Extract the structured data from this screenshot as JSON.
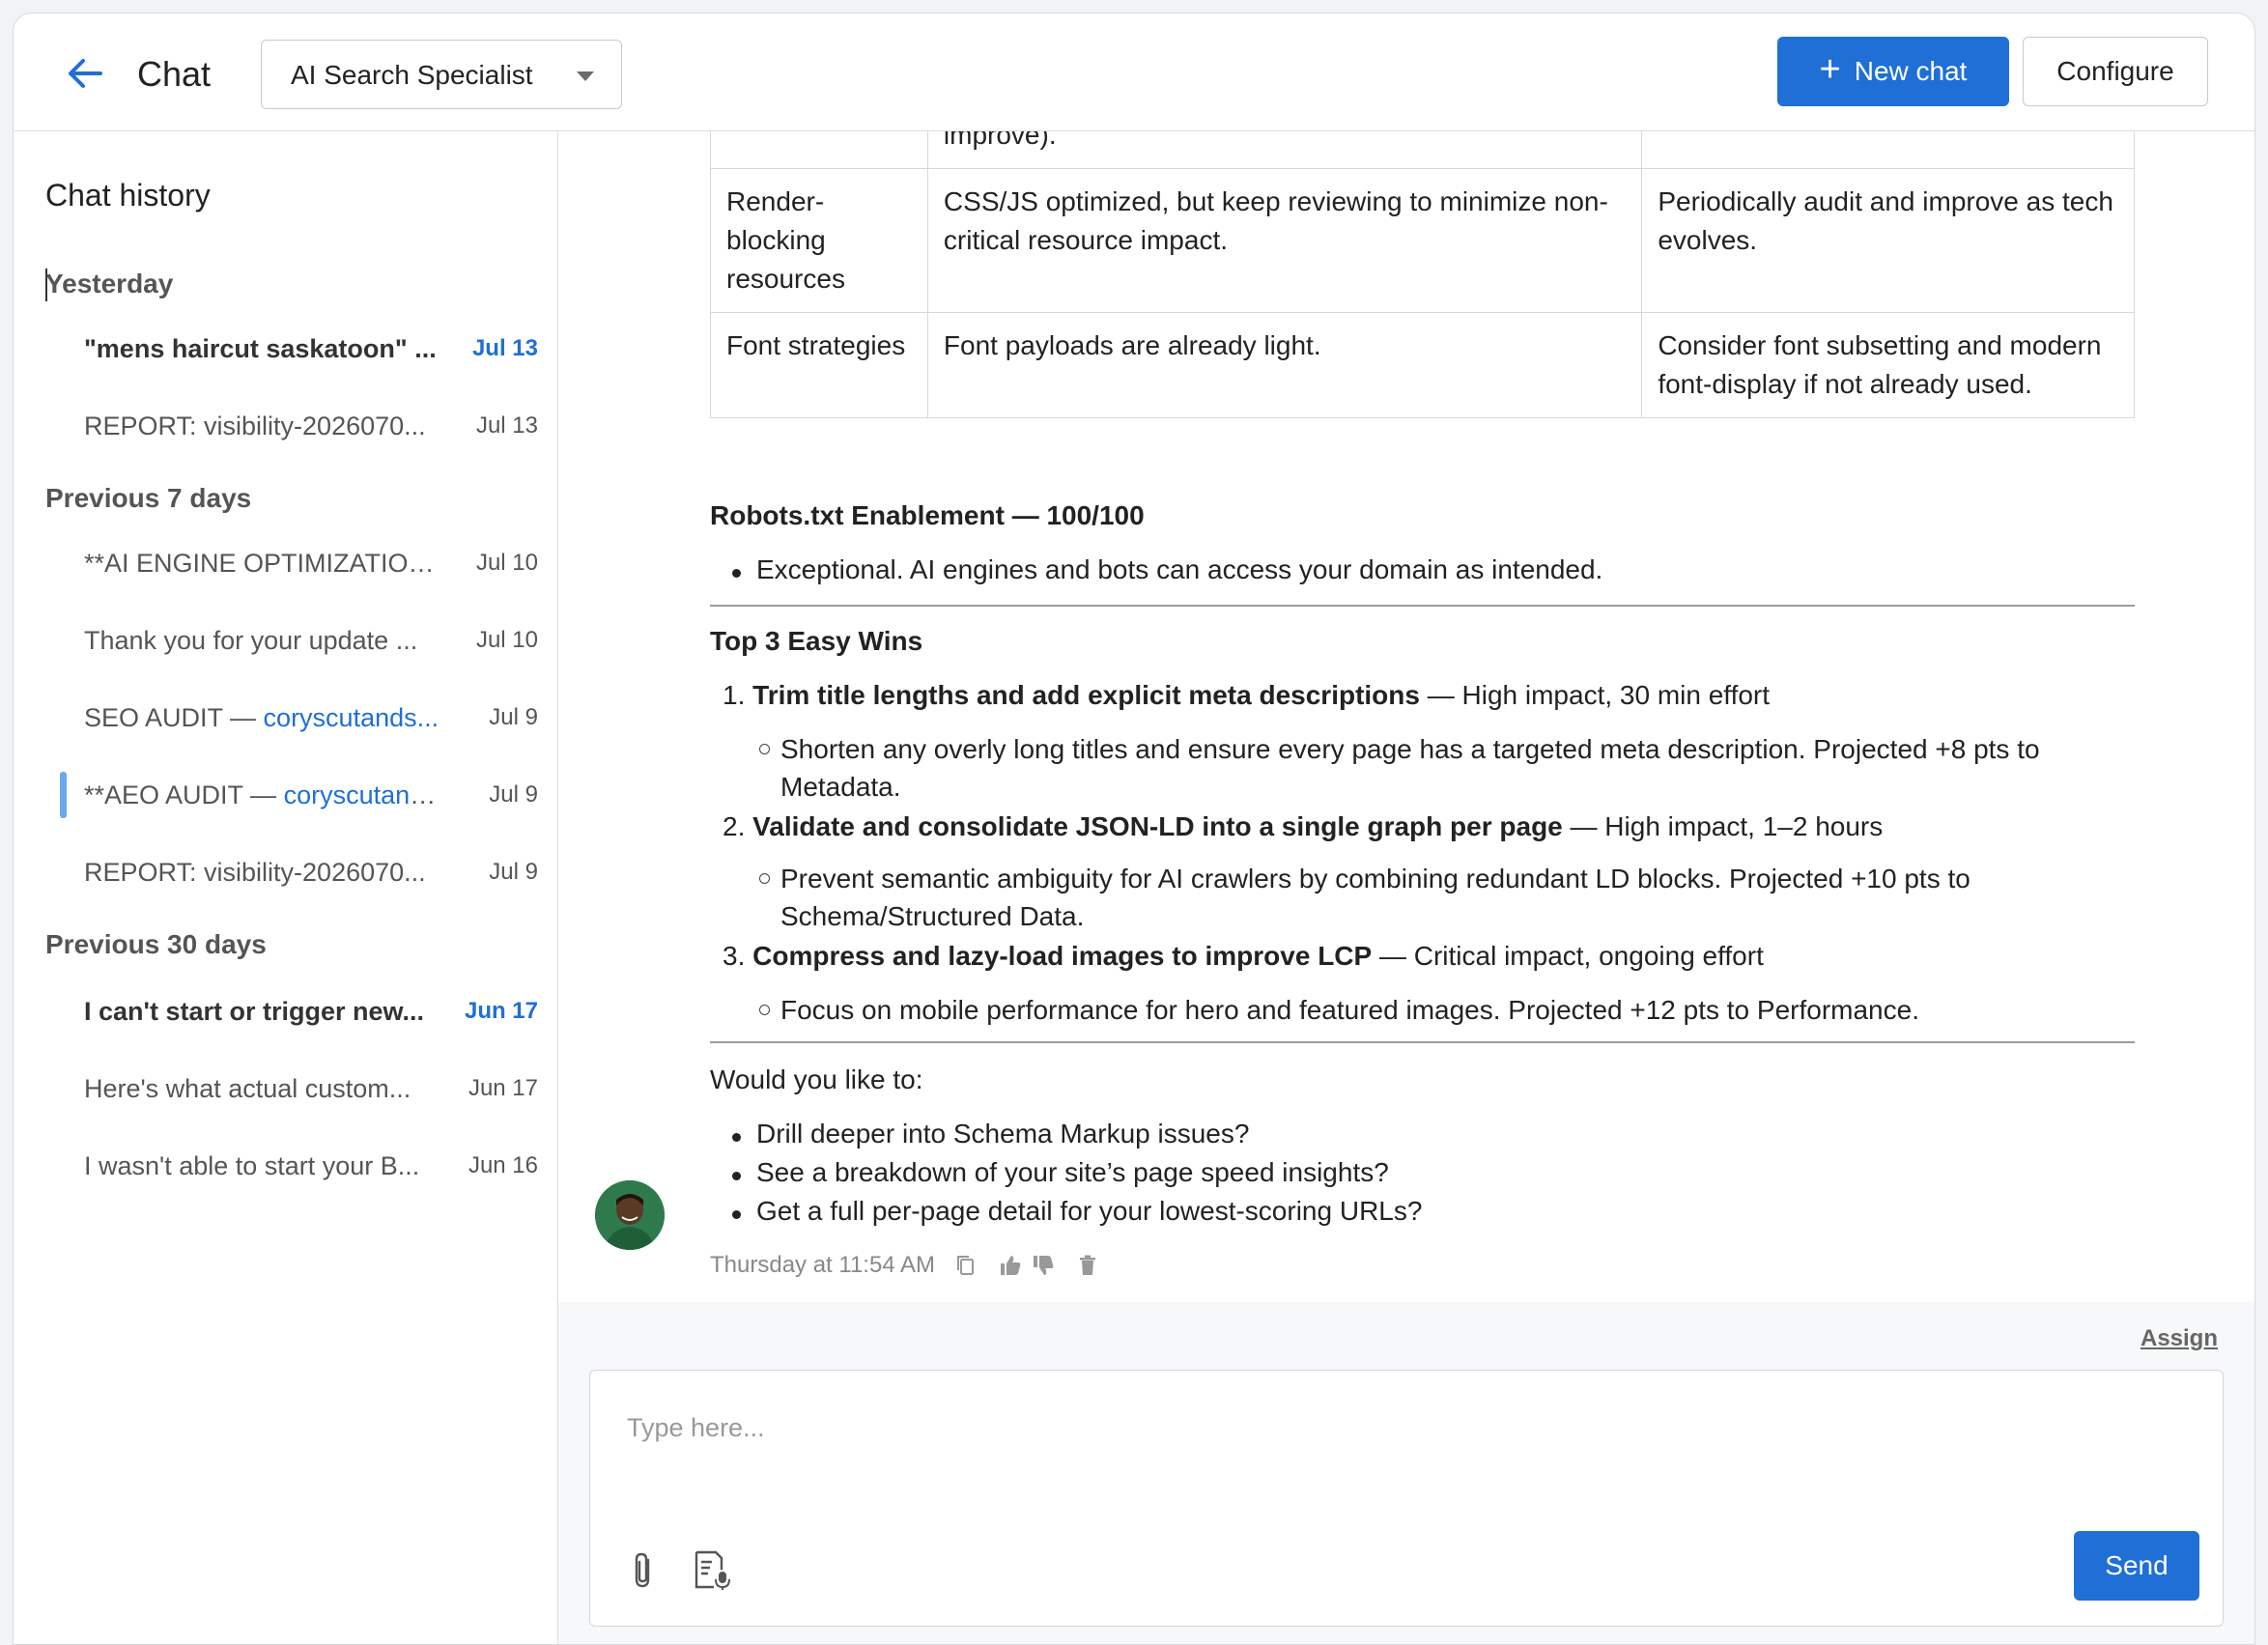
{
  "header": {
    "title": "Chat",
    "agent": "AI Search Specialist",
    "new_chat": "New chat",
    "configure": "Configure"
  },
  "sidebar": {
    "title": "Chat history",
    "groups": [
      {
        "label": "Yesterday"
      },
      {
        "label": "Previous 7 days"
      },
      {
        "label": "Previous 30 days"
      }
    ],
    "items": [
      {
        "text": "\"mens haircut saskatoon\" ...",
        "date": "Jul 13"
      },
      {
        "text": "REPORT: visibility-2026070...",
        "date": "Jul 13"
      },
      {
        "text": "**AI ENGINE OPTIMIZATION...",
        "date": "Jul 10"
      },
      {
        "text": "Thank you for your update ...",
        "date": "Jul 10"
      },
      {
        "text_prefix": "SEO AUDIT — ",
        "text_link": "coryscutands...",
        "date": "Jul 9"
      },
      {
        "text_prefix": "**AEO AUDIT — ",
        "text_link": "coryscutand...",
        "date": "Jul 9"
      },
      {
        "text": "REPORT: visibility-2026070...",
        "date": "Jul 9"
      },
      {
        "text": "I can't start or trigger new...",
        "date": "Jun 17"
      },
      {
        "text": "Here's what actual custom...",
        "date": "Jun 17"
      },
      {
        "text": "I wasn't able to start your B...",
        "date": "Jun 16"
      }
    ]
  },
  "message": {
    "table": [
      {
        "c1": "",
        "c2": "improve).",
        "c3": ""
      },
      {
        "c1": "Render-blocking resources",
        "c2": "CSS/JS optimized, but keep reviewing to minimize non-critical resource impact.",
        "c3": "Periodically audit and improve as tech evolves."
      },
      {
        "c1": "Font strategies",
        "c2": "Font payloads are already light.",
        "c3": "Consider font subsetting and modern font-display if not already used."
      }
    ],
    "robots_heading": "Robots.txt Enablement — 100/100",
    "robots_bullet": "Exceptional. AI engines and bots can access your domain as intended.",
    "wins_heading": "Top 3 Easy Wins",
    "wins": [
      {
        "num": "1.",
        "bold": "Trim title lengths and add explicit meta descriptions",
        "rest": " — High impact, 30 min effort",
        "sub": "Shorten any overly long titles and ensure every page has a targeted meta description. Projected +8 pts to Metadata."
      },
      {
        "num": "2.",
        "bold": "Validate and consolidate JSON-LD into a single graph per page",
        "rest": " — High impact, 1–2 hours",
        "sub": "Prevent semantic ambiguity for AI crawlers by combining redundant LD blocks. Projected +10 pts to Schema/Structured Data."
      },
      {
        "num": "3.",
        "bold": "Compress and lazy-load images to improve LCP",
        "rest": " — Critical impact, ongoing effort",
        "sub": "Focus on mobile performance for hero and featured images. Projected +12 pts to Performance."
      }
    ],
    "question": "Would you like to:",
    "options": [
      "Drill deeper into Schema Markup issues?",
      "See a breakdown of your site’s page speed insights?",
      "Get a full per-page detail for your lowest-scoring URLs?"
    ],
    "timestamp": "Thursday at 11:54 AM"
  },
  "composer": {
    "assign": "Assign",
    "placeholder": "Type here...",
    "send": "Send"
  },
  "colors": {
    "accent": "#1f6fd6",
    "active_indicator": "#6aa8f0"
  }
}
